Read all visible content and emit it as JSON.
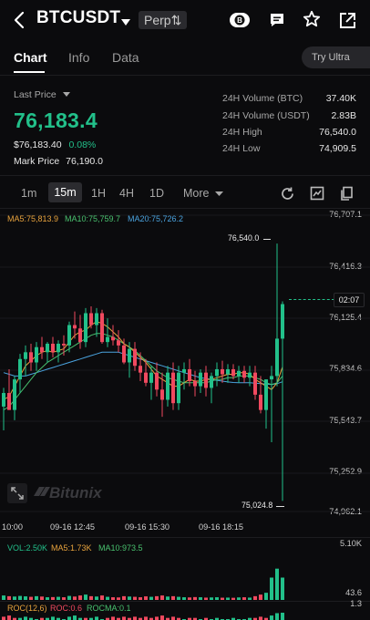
{
  "header": {
    "symbol": "BTCUSDT",
    "perp_label": "Perp⇅",
    "back_icon": "chevron-left-icon",
    "dropdown_icon": "caret-down-icon",
    "coin_icon": "coin-b-icon",
    "chat_icon": "message-icon",
    "star_icon": "star-icon",
    "share_icon": "share-icon"
  },
  "tabs": [
    {
      "label": "Chart",
      "active": true
    },
    {
      "label": "Info",
      "active": false
    },
    {
      "label": "Data",
      "active": false
    }
  ],
  "try_ultra": "Try Ultra",
  "ticker": {
    "last_price_label": "Last Price",
    "last_price": "76,183.4",
    "usd_price": "$76,183.40",
    "change_pct": "0.08%",
    "mark_price_label": "Mark Price",
    "mark_price": "76,190.0",
    "stats": [
      {
        "label": "24H Volume (BTC)",
        "value": "37.40K"
      },
      {
        "label": "24H Volume (USDT)",
        "value": "2.83B"
      },
      {
        "label": "24H High",
        "value": "76,540.0"
      },
      {
        "label": "24H Low",
        "value": "74,909.5"
      }
    ]
  },
  "timeframes": {
    "items": [
      "1m",
      "15m",
      "1H",
      "4H",
      "1D"
    ],
    "selected": "15m",
    "more_label": "More"
  },
  "indicators": {
    "ma5": "MA5:75,813.9",
    "ma10": "MA10:75,759.7",
    "ma20": "MA20:75,726.2"
  },
  "price_axis": [
    "76,707.1",
    "76,416.3",
    "76,125.4",
    "75,834.6",
    "75,543.7",
    "75,252.9",
    "74,962.1"
  ],
  "time_axis": [
    "10:00",
    "09-16 12:45",
    "09-16 15:30",
    "09-16 18:15"
  ],
  "annotations": {
    "high_marker": "76,540.0",
    "low_marker": "75,024.8",
    "countdown": "02:07"
  },
  "watermark": "Bitunix",
  "volume": {
    "vol": "VOL:2.50K",
    "ma5": "MA5:1.73K",
    "ma10": "MA10:973.5",
    "axis_top": "5.10K",
    "axis_bottom": "43.6"
  },
  "roc": {
    "roc": "ROC(12,6)",
    "roc_val": "ROC:0.6",
    "rocma": "ROCMA:0.1",
    "axis": "1.3"
  },
  "colors": {
    "up": "#22c08a",
    "down": "#f0495f",
    "ma5": "#e8a33d",
    "ma10": "#49c26f",
    "ma20": "#4aa3df",
    "background": "#0b0b0d"
  },
  "candles": [
    {
      "t": 0,
      "o": 75580,
      "h": 75690,
      "l": 75440,
      "c": 75660
    },
    {
      "t": 1,
      "o": 75660,
      "h": 75800,
      "l": 75560,
      "c": 75560
    },
    {
      "t": 2,
      "o": 75560,
      "h": 75760,
      "l": 75500,
      "c": 75740
    },
    {
      "t": 3,
      "o": 75740,
      "h": 75890,
      "l": 75660,
      "c": 75860
    },
    {
      "t": 4,
      "o": 75860,
      "h": 75940,
      "l": 75760,
      "c": 75900
    },
    {
      "t": 5,
      "o": 75900,
      "h": 75950,
      "l": 75790,
      "c": 75840
    },
    {
      "t": 6,
      "o": 75840,
      "h": 75960,
      "l": 75790,
      "c": 75930
    },
    {
      "t": 7,
      "o": 75930,
      "h": 75990,
      "l": 75860,
      "c": 75900
    },
    {
      "t": 8,
      "o": 75900,
      "h": 75960,
      "l": 75840,
      "c": 75950
    },
    {
      "t": 9,
      "o": 75950,
      "h": 75990,
      "l": 75870,
      "c": 75900
    },
    {
      "t": 10,
      "o": 75900,
      "h": 75970,
      "l": 75840,
      "c": 75950
    },
    {
      "t": 11,
      "o": 75950,
      "h": 76000,
      "l": 75880,
      "c": 75940
    },
    {
      "t": 12,
      "o": 75940,
      "h": 76080,
      "l": 75900,
      "c": 76060
    },
    {
      "t": 13,
      "o": 76060,
      "h": 76140,
      "l": 75980,
      "c": 76040
    },
    {
      "t": 14,
      "o": 76040,
      "h": 76120,
      "l": 75920,
      "c": 75960
    },
    {
      "t": 15,
      "o": 75960,
      "h": 76160,
      "l": 75930,
      "c": 76130
    },
    {
      "t": 16,
      "o": 76130,
      "h": 76170,
      "l": 76040,
      "c": 76060
    },
    {
      "t": 17,
      "o": 76060,
      "h": 76160,
      "l": 75990,
      "c": 76130
    },
    {
      "t": 18,
      "o": 76130,
      "h": 76150,
      "l": 75950,
      "c": 75960
    },
    {
      "t": 19,
      "o": 75960,
      "h": 76100,
      "l": 75930,
      "c": 75990
    },
    {
      "t": 20,
      "o": 75990,
      "h": 76060,
      "l": 75940,
      "c": 75970
    },
    {
      "t": 21,
      "o": 75970,
      "h": 76030,
      "l": 75900,
      "c": 75940
    },
    {
      "t": 22,
      "o": 75940,
      "h": 75980,
      "l": 75830,
      "c": 75840
    },
    {
      "t": 23,
      "o": 75840,
      "h": 75960,
      "l": 75750,
      "c": 75920
    },
    {
      "t": 24,
      "o": 75920,
      "h": 75960,
      "l": 75790,
      "c": 75820
    },
    {
      "t": 25,
      "o": 75820,
      "h": 75900,
      "l": 75730,
      "c": 75780
    },
    {
      "t": 26,
      "o": 75780,
      "h": 75860,
      "l": 75700,
      "c": 75720
    },
    {
      "t": 27,
      "o": 75720,
      "h": 75820,
      "l": 75620,
      "c": 75780
    },
    {
      "t": 28,
      "o": 75780,
      "h": 75840,
      "l": 75640,
      "c": 75680
    },
    {
      "t": 29,
      "o": 75680,
      "h": 75780,
      "l": 75520,
      "c": 75620
    },
    {
      "t": 30,
      "o": 75620,
      "h": 75820,
      "l": 75580,
      "c": 75780
    },
    {
      "t": 31,
      "o": 75780,
      "h": 75840,
      "l": 75560,
      "c": 75600
    },
    {
      "t": 32,
      "o": 75600,
      "h": 75820,
      "l": 75560,
      "c": 75780
    },
    {
      "t": 33,
      "o": 75780,
      "h": 75840,
      "l": 75680,
      "c": 75800
    },
    {
      "t": 34,
      "o": 75800,
      "h": 75860,
      "l": 75700,
      "c": 75730
    },
    {
      "t": 35,
      "o": 75730,
      "h": 75790,
      "l": 75640,
      "c": 75700
    },
    {
      "t": 36,
      "o": 75700,
      "h": 75800,
      "l": 75660,
      "c": 75780
    },
    {
      "t": 37,
      "o": 75780,
      "h": 75820,
      "l": 75640,
      "c": 75690
    },
    {
      "t": 38,
      "o": 75690,
      "h": 75780,
      "l": 75600,
      "c": 75760
    },
    {
      "t": 39,
      "o": 75760,
      "h": 75840,
      "l": 75700,
      "c": 75800
    },
    {
      "t": 40,
      "o": 75800,
      "h": 75850,
      "l": 75720,
      "c": 75770
    },
    {
      "t": 41,
      "o": 75770,
      "h": 75830,
      "l": 75720,
      "c": 75800
    },
    {
      "t": 42,
      "o": 75800,
      "h": 75830,
      "l": 75740,
      "c": 75760
    },
    {
      "t": 43,
      "o": 75760,
      "h": 75820,
      "l": 75720,
      "c": 75790
    },
    {
      "t": 44,
      "o": 75790,
      "h": 75820,
      "l": 75720,
      "c": 75750
    },
    {
      "t": 45,
      "o": 75750,
      "h": 75820,
      "l": 75700,
      "c": 75780
    },
    {
      "t": 46,
      "o": 75780,
      "h": 75820,
      "l": 75620,
      "c": 75650
    },
    {
      "t": 47,
      "o": 75650,
      "h": 75760,
      "l": 75540,
      "c": 75560
    },
    {
      "t": 48,
      "o": 75560,
      "h": 75740,
      "l": 75450,
      "c": 75740
    },
    {
      "t": 49,
      "o": 75740,
      "h": 75820,
      "l": 75370,
      "c": 75760
    },
    {
      "t": 50,
      "o": 75760,
      "h": 76540,
      "l": 75700,
      "c": 75980
    },
    {
      "t": 51,
      "o": 75980,
      "h": 76200,
      "l": 75024.8,
      "c": 76183.4
    }
  ],
  "volumes": [
    500,
    420,
    380,
    450,
    400,
    350,
    420,
    380,
    300,
    320,
    350,
    300,
    450,
    380,
    500,
    600,
    420,
    380,
    500,
    350,
    300,
    280,
    420,
    380,
    350,
    300,
    400,
    350,
    420,
    500,
    380,
    420,
    350,
    300,
    280,
    320,
    300,
    260,
    280,
    300,
    250,
    260,
    240,
    280,
    300,
    260,
    420,
    600,
    800,
    2500,
    3500,
    2500
  ],
  "ma_series": {
    "ma5": [
      75620,
      75640,
      75700,
      75760,
      75820,
      75850,
      75880,
      75900,
      75910,
      75900,
      75910,
      75920,
      75960,
      76000,
      76020,
      76030,
      76060,
      76080,
      76070,
      76050,
      76020,
      75990,
      75950,
      75930,
      75900,
      75870,
      75840,
      75800,
      75760,
      75740,
      75720,
      75700,
      75700,
      75720,
      75740,
      75730,
      75730,
      75740,
      75740,
      75750,
      75760,
      75770,
      75770,
      75780,
      75780,
      75770,
      75740,
      75720,
      75700,
      75680,
      75720,
      75813.9
    ],
    "ma10": [
      75560,
      75580,
      75620,
      75660,
      75700,
      75740,
      75780,
      75810,
      75840,
      75860,
      75880,
      75900,
      75920,
      75940,
      75960,
      75980,
      76000,
      76010,
      76010,
      76000,
      75990,
      75970,
      75950,
      75930,
      75910,
      75880,
      75850,
      75820,
      75790,
      75770,
      75750,
      75740,
      75730,
      75720,
      75720,
      75720,
      75720,
      75720,
      75730,
      75740,
      75740,
      75750,
      75750,
      75760,
      75760,
      75760,
      75750,
      75740,
      75720,
      75710,
      75720,
      75759.7
    ],
    "ma20": [
      75780,
      75770,
      75760,
      75760,
      75760,
      75770,
      75780,
      75790,
      75800,
      75810,
      75820,
      75830,
      75840,
      75850,
      75860,
      75870,
      75880,
      75890,
      75900,
      75900,
      75900,
      75900,
      75890,
      75880,
      75870,
      75860,
      75850,
      75840,
      75830,
      75820,
      75810,
      75800,
      75790,
      75780,
      75770,
      75760,
      75750,
      75745,
      75740,
      75735,
      75730,
      75725,
      75722,
      75720,
      75720,
      75720,
      75718,
      75715,
      75712,
      75710,
      75715,
      75726.2
    ]
  },
  "roc_values": [
    -2,
    -3,
    -1,
    1,
    2,
    1,
    0,
    -1,
    1,
    2,
    1,
    0,
    2,
    3,
    1,
    -1,
    1,
    2,
    0,
    -1,
    -2,
    -1,
    -2,
    -1,
    -2,
    -1,
    -2,
    -1,
    -2,
    -3,
    -1,
    -2,
    -1,
    0,
    -1,
    -1,
    0,
    -1,
    0,
    1,
    0,
    0,
    1,
    0,
    0,
    1,
    -1,
    -2,
    -1,
    3,
    5,
    6
  ]
}
